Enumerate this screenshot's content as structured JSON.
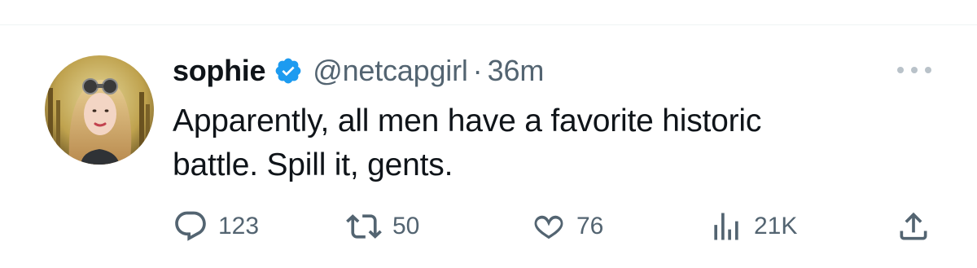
{
  "tweet": {
    "author_name": "sophie",
    "handle": "@netcapgirl",
    "separator": "·",
    "time": "36m",
    "text_line1": "Apparently, all men have a favorite historic",
    "text_line2": "battle. Spill it, gents."
  },
  "icons": {
    "verified": "verified-badge-icon",
    "more": "more-options-icon",
    "reply": "reply-icon",
    "retweet": "retweet-icon",
    "like": "heart-icon",
    "views": "views-icon",
    "share": "share-icon"
  },
  "stats": {
    "replies": "123",
    "retweets": "50",
    "likes": "76",
    "views": "21K"
  },
  "colors": {
    "text": "#0f1419",
    "secondary": "#536471",
    "verified_blue": "#1d9bf0"
  }
}
